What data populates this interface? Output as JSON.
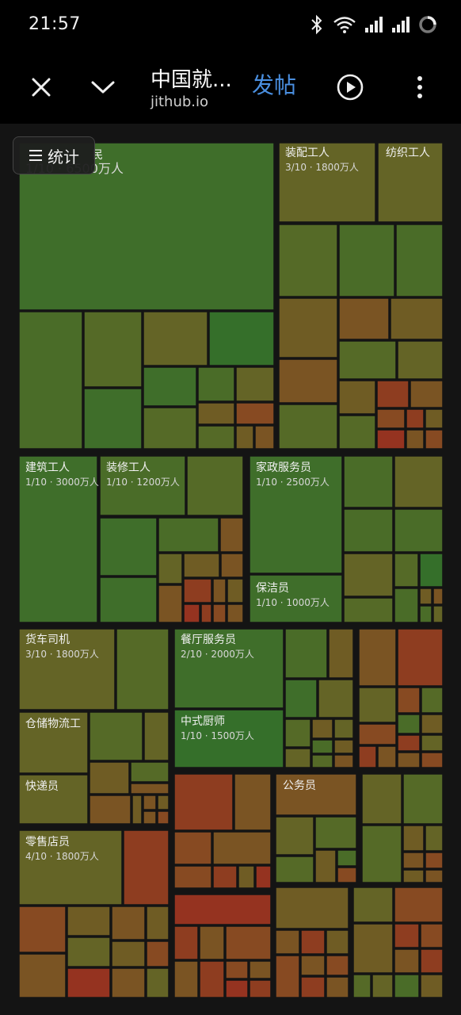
{
  "status_bar": {
    "time": "21:57",
    "icons": [
      "bluetooth-icon",
      "wifi-icon",
      "signal-icon",
      "signal-icon",
      "loading-ring-icon"
    ]
  },
  "toolbar": {
    "title": "中国就...",
    "url": "jithub.io",
    "post_label": "发帖",
    "icons": [
      "close-icon",
      "chevron-down-icon",
      "play-circle-icon",
      "more-vertical-icon"
    ],
    "accent_color": "#4a8fe0"
  },
  "stats_button": {
    "label": "统计",
    "icon": "menu-icon"
  },
  "treemap": {
    "labels": [
      {
        "name": "民",
        "detail": "1/10 · 6500万人"
      },
      {
        "name": "装配工人",
        "detail": "3/10 · 1800万人"
      },
      {
        "name": "纺织工人",
        "detail": ""
      },
      {
        "name": "建筑工人",
        "detail": "1/10 · 3000万人"
      },
      {
        "name": "装修工人",
        "detail": "1/10 · 1200万人"
      },
      {
        "name": "家政服务员",
        "detail": "1/10 · 2500万人"
      },
      {
        "name": "保洁员",
        "detail": "1/10 · 1000万人"
      },
      {
        "name": "货车司机",
        "detail": "3/10 · 1800万人"
      },
      {
        "name": "餐厅服务员",
        "detail": "2/10 · 2000万人"
      },
      {
        "name": "中式厨师",
        "detail": "1/10 · 1500万人"
      },
      {
        "name": "仓储物流工",
        "detail": ""
      },
      {
        "name": "快递员",
        "detail": ""
      },
      {
        "name": "公务员",
        "detail": ""
      },
      {
        "name": "零售店员",
        "detail": "4/10 · 1800万人"
      }
    ]
  }
}
